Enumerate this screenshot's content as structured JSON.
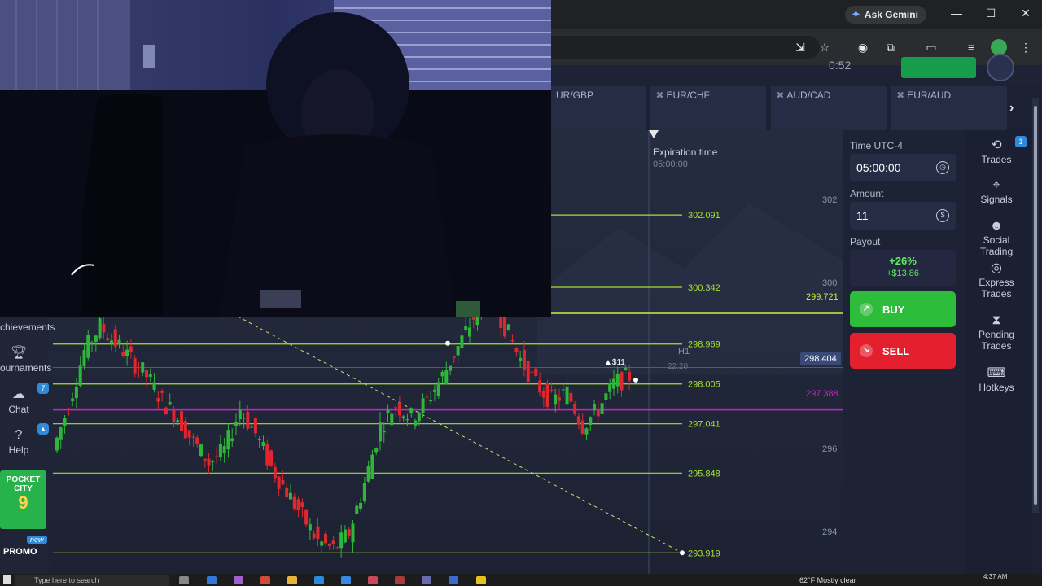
{
  "browser": {
    "gemini_label": "Ask Gemini",
    "minimize_glyph": "—",
    "maximize_glyph": "☐",
    "close_glyph": "✕"
  },
  "header": {
    "timer_text": "0:52"
  },
  "asset_tabs": [
    {
      "label": "UR/GBP"
    },
    {
      "label": "EUR/CHF"
    },
    {
      "label": "AUD/CAD"
    },
    {
      "label": "EUR/AUD"
    }
  ],
  "chart": {
    "expiration_label": "Expiration time",
    "expiration_value": "05:00:00",
    "timeframe": "H1",
    "time_marker": "22:20",
    "trade_marker": "$11",
    "current_price": "298.404",
    "pink_level": "297.388",
    "yellow_level": "299.721",
    "axis_ticks": [
      "302",
      "300",
      "298",
      "296",
      "294"
    ],
    "level_labels": [
      "302.091",
      "300.342",
      "298.969",
      "298.005",
      "297.041",
      "295.848",
      "293.919"
    ]
  },
  "chart_data": {
    "type": "line",
    "title": "",
    "timeframe": "H1",
    "horizontal_levels": [
      302.091,
      300.342,
      299.721,
      298.969,
      298.005,
      297.388,
      297.041,
      295.848,
      293.919
    ],
    "current_price": 298.404,
    "ylim": [
      293.5,
      302.5
    ],
    "y_ticks": [
      302,
      300,
      298,
      296,
      294
    ]
  },
  "left_nav": {
    "achievements": "chievements",
    "tournaments": "ournaments",
    "chat": "Chat",
    "chat_badge": "7",
    "help": "Help",
    "promo_card_line1": "POCKET",
    "promo_card_line2": "CITY",
    "promo_card_num": "9",
    "new_badge": "new",
    "promo": "PROMO"
  },
  "trade_panel": {
    "time_label": "Time UTC-4",
    "time_value": "05:00:00",
    "amount_label": "Amount",
    "amount_value": "11",
    "payout_label": "Payout",
    "payout_pct": "+26%",
    "payout_amount": "+$13.86",
    "buy_label": "BUY",
    "sell_label": "SELL"
  },
  "right_menu": {
    "trades": "Trades",
    "trades_badge": "1",
    "signals": "Signals",
    "social_trading": "Social Trading",
    "express_line1": "Express",
    "express_line2": "Trades",
    "pending_line1": "Pending",
    "pending_line2": "Trades",
    "hotkeys": "Hotkeys"
  },
  "taskbar": {
    "search_placeholder": "Type here to search",
    "weather": "62°F  Mostly clear",
    "time": "4:37 AM"
  },
  "colors": {
    "buy": "#2ebd3b",
    "sell": "#e4202e",
    "level_line": "#a6e22e",
    "pink_line": "#d21fd0",
    "bull": "#2fb53a",
    "bear": "#e0262e"
  }
}
